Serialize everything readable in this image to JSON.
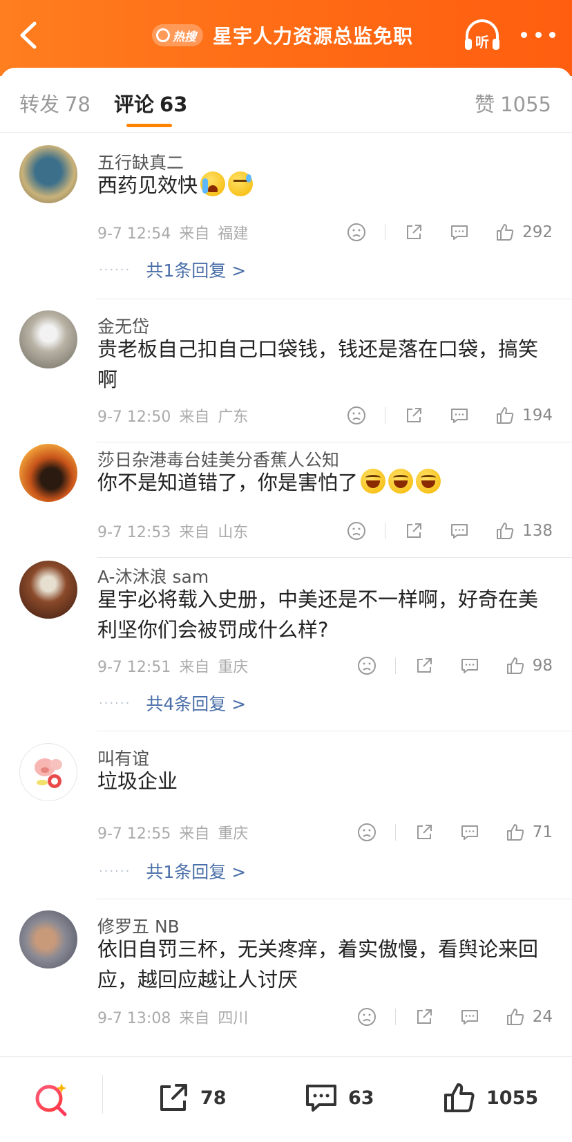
{
  "header": {
    "hot_badge": "热搜",
    "title": "星宇人力资源总监免职",
    "listen_label": "听"
  },
  "tabs": {
    "repost": {
      "label": "转发",
      "count": "78"
    },
    "comment": {
      "label": "评论",
      "count": "63"
    },
    "like": {
      "label": "赞",
      "count": "1055"
    }
  },
  "comments": [
    {
      "name": "五行缺真二",
      "text": "西药见效快",
      "emojis": [
        "cry",
        "sweat"
      ],
      "time": "9-7 12:54",
      "from": "来自",
      "location": "福建",
      "likes": "292",
      "replies": "共1条回复 >"
    },
    {
      "name": "金无岱",
      "text": "贵老板自己扣自己口袋钱，钱还是落在口袋，搞笑啊",
      "time": "9-7 12:50",
      "from": "来自",
      "location": "广东",
      "likes": "194"
    },
    {
      "name": "莎日杂港毒台娃美分香蕉人公知",
      "text": "你不是知道错了，你是害怕了",
      "emojis": [
        "laugh",
        "laugh",
        "laugh"
      ],
      "time": "9-7 12:53",
      "from": "来自",
      "location": "山东",
      "likes": "138"
    },
    {
      "name": "A-沐沐浪 sam",
      "text": "星宇必将载入史册，中美还是不一样啊，好奇在美利坚你们会被罚成什么样?",
      "time": "9-7 12:51",
      "from": "来自",
      "location": "重庆",
      "likes": "98",
      "replies": "共4条回复 >"
    },
    {
      "name": "叫有谊",
      "text": "垃圾企业",
      "time": "9-7 12:55",
      "from": "来自",
      "location": "重庆",
      "likes": "71",
      "replies": "共1条回复 >"
    },
    {
      "name": "修罗五 NB",
      "text": "依旧自罚三杯，无关疼痒，着实傲慢，看舆论来回应，越回应越让人讨厌",
      "time": "9-7 13:08",
      "from": "来自",
      "location": "四川",
      "likes": "24"
    }
  ],
  "bottom_bar": {
    "repost_count": "78",
    "comment_count": "63",
    "like_count": "1055"
  },
  "colors": {
    "header_orange": "#ff6a14",
    "tab_indicator": "#ff8200",
    "reply_link": "#4a6ea8"
  }
}
